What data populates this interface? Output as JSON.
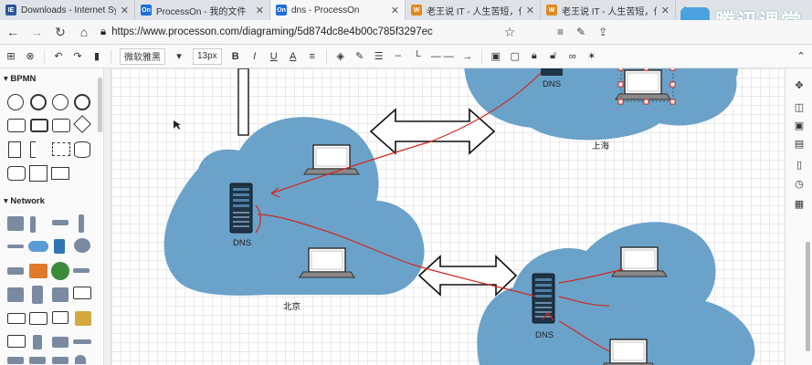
{
  "tabs": [
    {
      "label": "Downloads - Internet Syste",
      "fav_text": "IE",
      "fav_color": "#2b5797"
    },
    {
      "label": "ProcessOn - 我的文件",
      "fav_text": "On",
      "fav_color": "#1e6fd9"
    },
    {
      "label": "dns - ProcessOn",
      "fav_text": "On",
      "fav_color": "#1e6fd9"
    },
    {
      "label": "老王说 IT - 人生苦短，何必",
      "fav_text": "W",
      "fav_color": "#e08a1e"
    },
    {
      "label": "老王说 IT - 人生苦短，何必",
      "fav_text": "W",
      "fav_color": "#e08a1e"
    }
  ],
  "address": {
    "url": "https://www.processon.com/diagraming/5d874dc8e4b00c785f3297ec"
  },
  "watermark": "腾讯课堂",
  "toolbar": {
    "font": "微软雅黑",
    "size": "13px"
  },
  "sidebar": {
    "bpmn": "BPMN",
    "network": "Network"
  },
  "diagram": {
    "beijing_label": "北京",
    "shanghai_label": "上海",
    "dns_beijing": "DNS",
    "dns_shanghai": "DNS",
    "dns_third": "DNS"
  },
  "colors": {
    "cloud": "#6aa2c9",
    "annotation": "#d0281f"
  }
}
